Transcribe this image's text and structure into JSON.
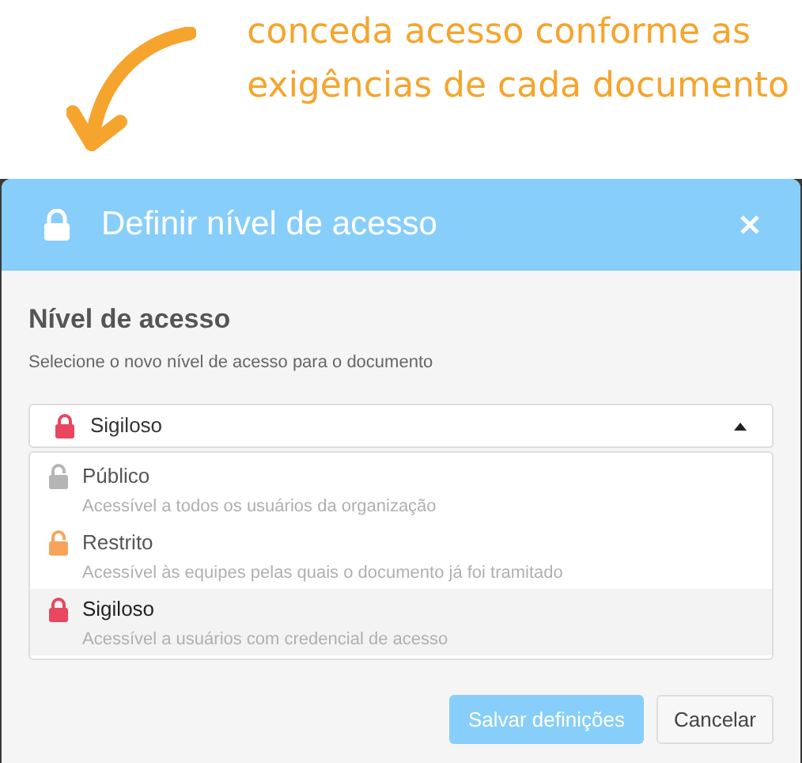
{
  "annotation": {
    "lines": [
      "conceda acesso conforme as",
      "exigências de cada documento"
    ]
  },
  "dialog": {
    "title": "Definir nível de acesso",
    "heading": "Nível de acesso",
    "description": "Selecione o novo nível de acesso para o documento",
    "select": {
      "value": "Sigiloso",
      "icon": {
        "kind": "locked",
        "color": "#e8475f"
      },
      "expanded": true
    },
    "options": [
      {
        "kind": "unlocked",
        "color": "#b5b5b5",
        "label": "Público",
        "description": "Acessível a todos os usuários da organização",
        "selected": false
      },
      {
        "kind": "unlocked",
        "color": "#f9a35a",
        "label": "Restrito",
        "description": "Acessível às equipes pelas quais o documento já foi tramitado",
        "selected": false
      },
      {
        "kind": "locked",
        "color": "#e8475f",
        "label": "Sigiloso",
        "description": "Acessível a usuários com credencial de acesso",
        "selected": true
      }
    ],
    "buttons": [
      {
        "kind": "primary",
        "label": "Salvar definições"
      },
      {
        "kind": "secondary",
        "label": "Cancelar"
      }
    ]
  }
}
